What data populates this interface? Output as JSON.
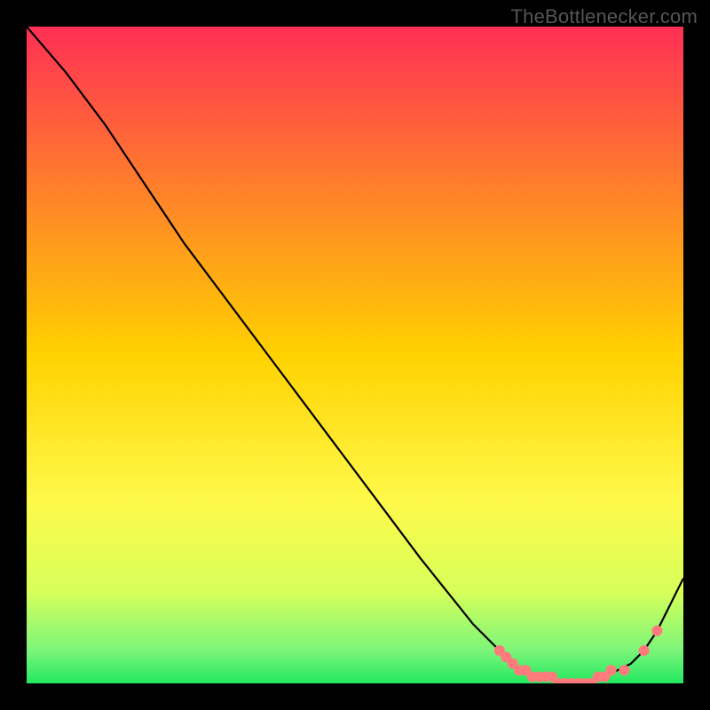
{
  "watermark": "TheBottlenecker.com",
  "chart_data": {
    "type": "line",
    "title": "",
    "xlabel": "",
    "ylabel": "",
    "xlim": [
      0,
      100
    ],
    "ylim": [
      0,
      100
    ],
    "background_gradient": {
      "stops": [
        {
          "t": 0.0,
          "color": "#ff2f55"
        },
        {
          "t": 0.5,
          "color": "#ffd200"
        },
        {
          "t": 0.72,
          "color": "#fff94a"
        },
        {
          "t": 0.86,
          "color": "#d7ff5a"
        },
        {
          "t": 0.95,
          "color": "#7cf57a"
        },
        {
          "t": 1.0,
          "color": "#23e860"
        }
      ]
    },
    "series": [
      {
        "name": "main",
        "x": [
          0,
          6,
          12,
          18,
          24,
          30,
          36,
          42,
          48,
          54,
          60,
          64,
          68,
          72,
          74,
          76,
          78,
          80,
          82,
          84,
          86,
          88,
          90,
          92,
          94,
          96,
          98,
          100
        ],
        "y": [
          100,
          93,
          85,
          76,
          67,
          59,
          51,
          43,
          35,
          27,
          19,
          14,
          9,
          5,
          3,
          2,
          1,
          1,
          0,
          0,
          0,
          1,
          2,
          3,
          5,
          8,
          12,
          16
        ]
      }
    ],
    "markers": {
      "name": "highlight",
      "color": "#ff7b7b",
      "x": [
        72,
        73,
        74,
        75,
        76,
        77,
        78,
        79,
        80,
        81,
        82,
        83,
        84,
        85,
        86,
        87,
        88,
        89,
        91,
        94,
        96
      ],
      "y": [
        5,
        4,
        3,
        2,
        2,
        1,
        1,
        1,
        1,
        0,
        0,
        0,
        0,
        0,
        0,
        1,
        1,
        2,
        2,
        5,
        8
      ]
    }
  }
}
